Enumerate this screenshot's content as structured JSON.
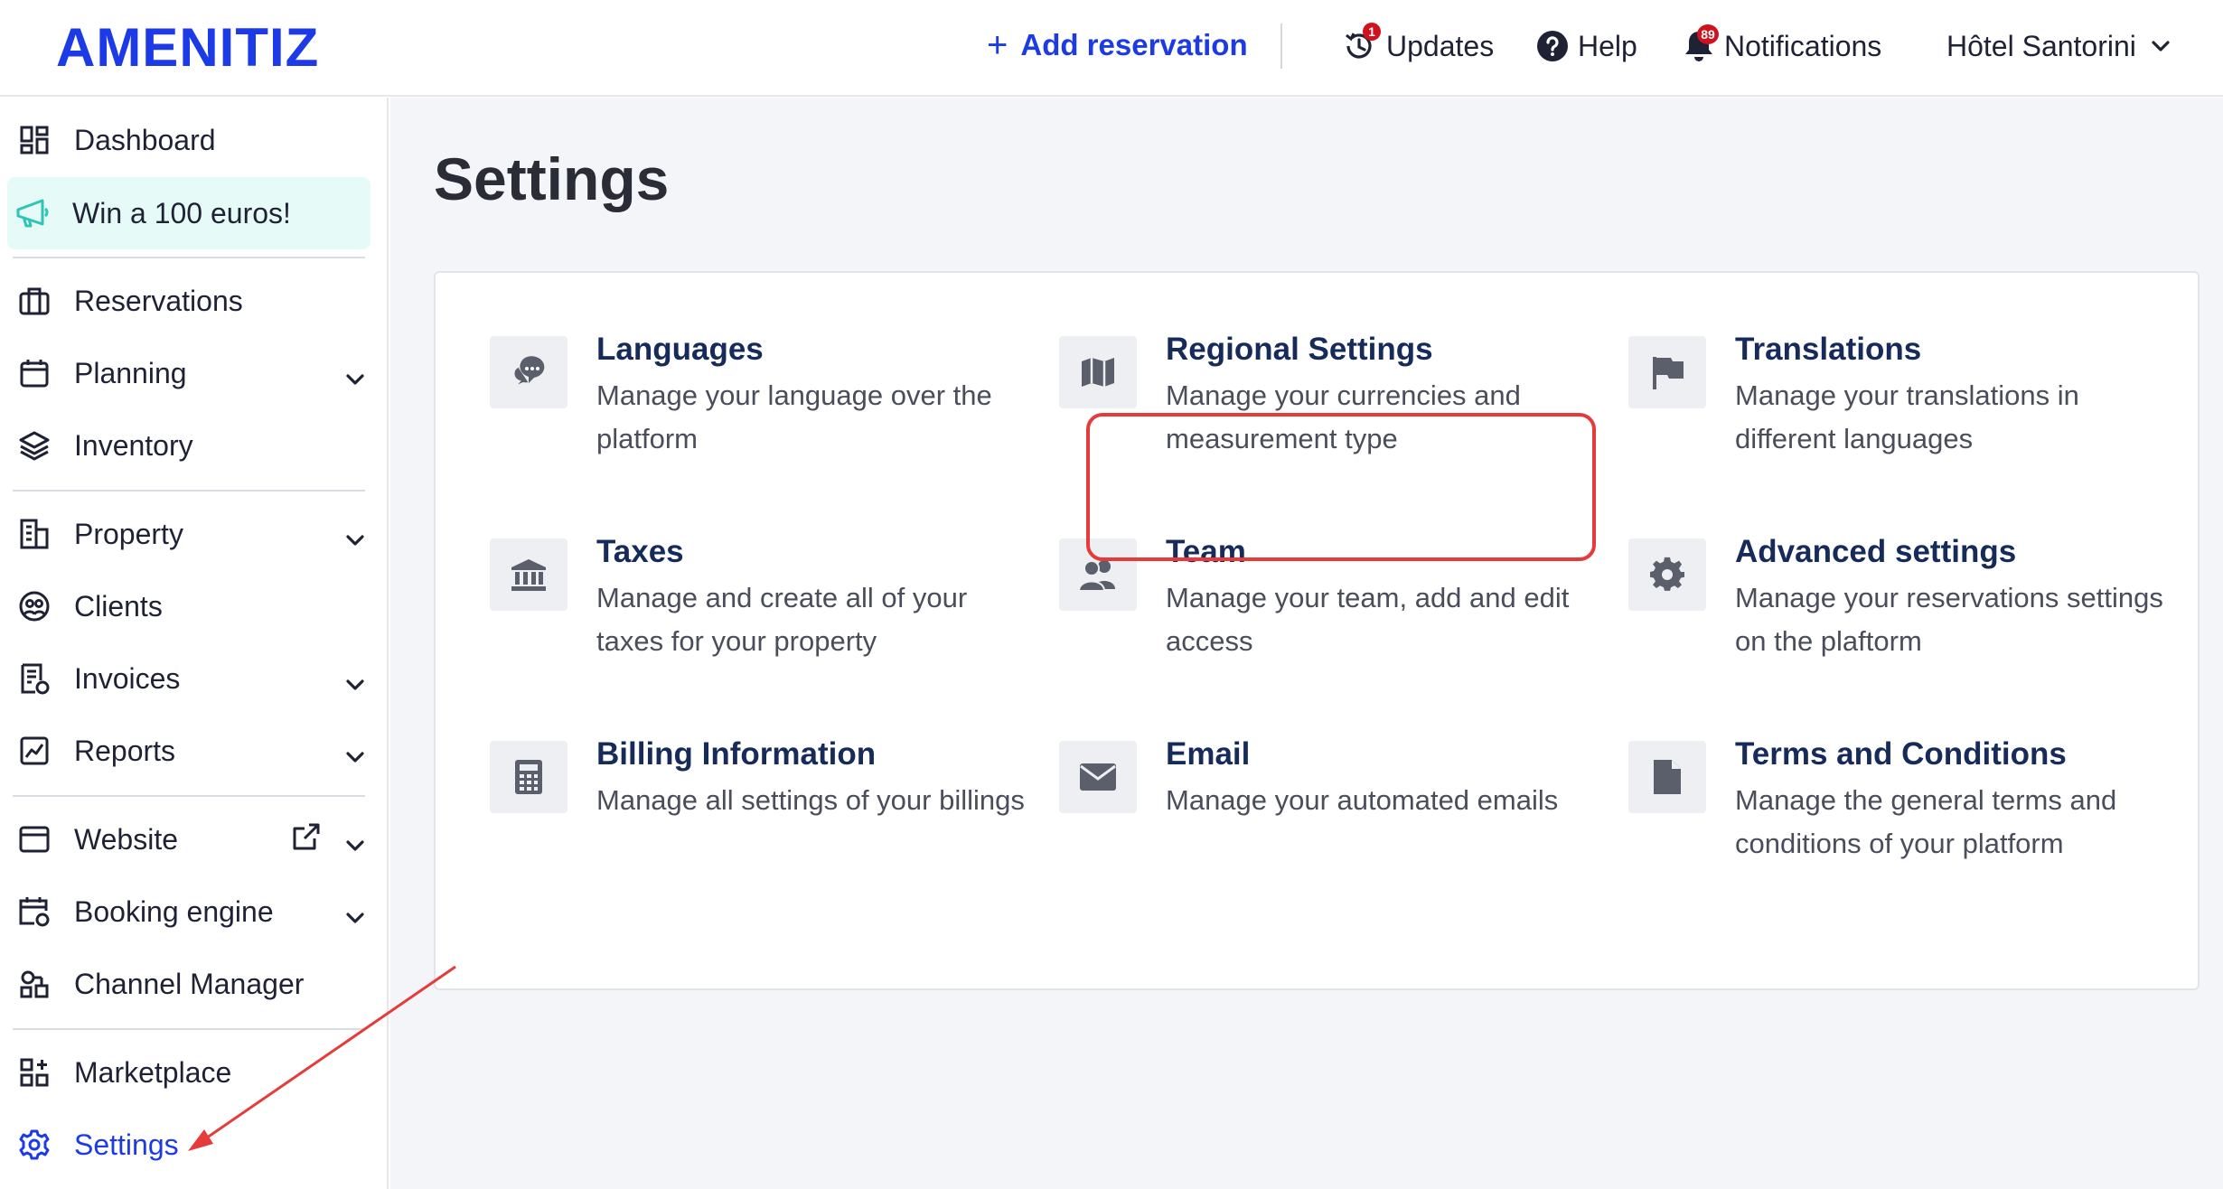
{
  "header": {
    "logo": "AMENITIZ",
    "add_reservation": "Add reservation",
    "updates": {
      "label": "Updates",
      "badge": "1"
    },
    "help": "Help",
    "notifications": {
      "label": "Notifications",
      "badge": "89"
    },
    "property_name": "Hôtel Santorini"
  },
  "sidebar": {
    "items": [
      {
        "label": "Dashboard",
        "icon": "dashboard-icon"
      },
      {
        "label": "Win a 100 euros!",
        "icon": "megaphone-icon"
      },
      {
        "label": "Reservations",
        "icon": "briefcase-icon"
      },
      {
        "label": "Planning",
        "icon": "calendar-icon"
      },
      {
        "label": "Inventory",
        "icon": "layers-icon"
      },
      {
        "label": "Property",
        "icon": "building-icon"
      },
      {
        "label": "Clients",
        "icon": "users-circle-icon"
      },
      {
        "label": "Invoices",
        "icon": "invoice-icon"
      },
      {
        "label": "Reports",
        "icon": "chart-icon"
      },
      {
        "label": "Website",
        "icon": "browser-icon"
      },
      {
        "label": "Booking engine",
        "icon": "booking-calendar-icon"
      },
      {
        "label": "Channel Manager",
        "icon": "channel-icon"
      },
      {
        "label": "Marketplace",
        "icon": "grid-plus-icon"
      },
      {
        "label": "Settings",
        "icon": "gear-icon"
      }
    ]
  },
  "main": {
    "title": "Settings",
    "tiles": [
      {
        "title": "Languages",
        "desc": "Manage your language over the platform",
        "icon": "chat-bubbles-icon"
      },
      {
        "title": "Regional Settings",
        "desc": "Manage your currencies and measurement type",
        "icon": "map-icon"
      },
      {
        "title": "Translations",
        "desc": "Manage your translations in different languages",
        "icon": "flag-icon"
      },
      {
        "title": "Taxes",
        "desc": "Manage and create all of your taxes for your property",
        "icon": "bank-icon"
      },
      {
        "title": "Team",
        "desc": "Manage your team, add and edit access",
        "icon": "team-icon"
      },
      {
        "title": "Advanced settings",
        "desc": "Manage your reservations settings on the plaftorm",
        "icon": "cog-icon"
      },
      {
        "title": "Billing Information",
        "desc": "Manage all settings of your billings",
        "icon": "calculator-icon"
      },
      {
        "title": "Email",
        "desc": "Manage your automated emails",
        "icon": "envelope-icon"
      },
      {
        "title": "Terms and Conditions",
        "desc": "Manage the general terms and conditions of your platform",
        "icon": "document-icon"
      }
    ]
  },
  "colors": {
    "brand": "#1c3be6",
    "highlight": "#e53b3b",
    "promo_bg": "#e6fbf8",
    "tile_title": "#172b5b"
  }
}
